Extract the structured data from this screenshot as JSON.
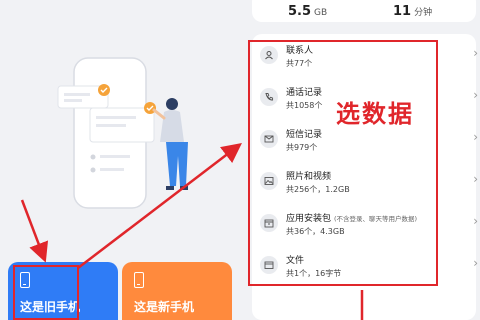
{
  "cards": {
    "old_phone": "这是旧手机",
    "new_phone": "这是新手机"
  },
  "stats": {
    "size_value": "5.5",
    "size_unit": "GB",
    "time_value": "11",
    "time_unit": "分钟"
  },
  "annotation": "选数据",
  "items": [
    {
      "icon": "contacts-icon",
      "title": "联系人",
      "note": "",
      "sub": "共77个"
    },
    {
      "icon": "phone-icon",
      "title": "通话记录",
      "note": "",
      "sub": "共1058个"
    },
    {
      "icon": "message-icon",
      "title": "短信记录",
      "note": "",
      "sub": "共979个"
    },
    {
      "icon": "photo-icon",
      "title": "照片和视频",
      "note": "",
      "sub": "共256个，1.2GB"
    },
    {
      "icon": "app-package-icon",
      "title": "应用安装包",
      "note": "(不含登录、聊天等用户数据)",
      "sub": "共36个，4.3GB"
    },
    {
      "icon": "file-icon",
      "title": "文件",
      "note": "",
      "sub": "共1个，16字节"
    }
  ],
  "colors": {
    "annotation_red": "#e0262b",
    "old_card_blue": "#2f7cf6",
    "new_card_orange": "#ff8a3d"
  }
}
